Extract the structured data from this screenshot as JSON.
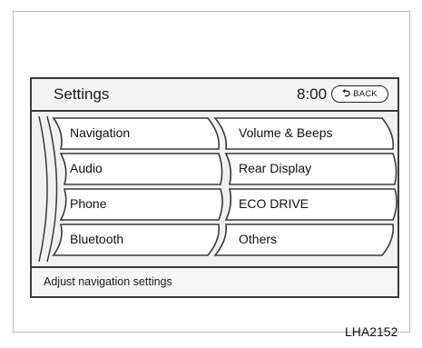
{
  "header": {
    "title": "Settings",
    "time": "8:00",
    "back_label": "BACK",
    "back_icon": "back-arrow-icon"
  },
  "menu": {
    "left": [
      {
        "label": "Navigation"
      },
      {
        "label": "Audio"
      },
      {
        "label": "Phone"
      },
      {
        "label": "Bluetooth"
      }
    ],
    "right": [
      {
        "label": "Volume & Beeps"
      },
      {
        "label": "Rear Display"
      },
      {
        "label": "ECO DRIVE"
      },
      {
        "label": "Others"
      }
    ]
  },
  "status": {
    "text": "Adjust navigation settings"
  },
  "figure": {
    "code": "LHA2152"
  },
  "colors": {
    "screen_background": "#f1f1f1",
    "outline": "#3a3a3a",
    "highlight": "#ffffff"
  }
}
